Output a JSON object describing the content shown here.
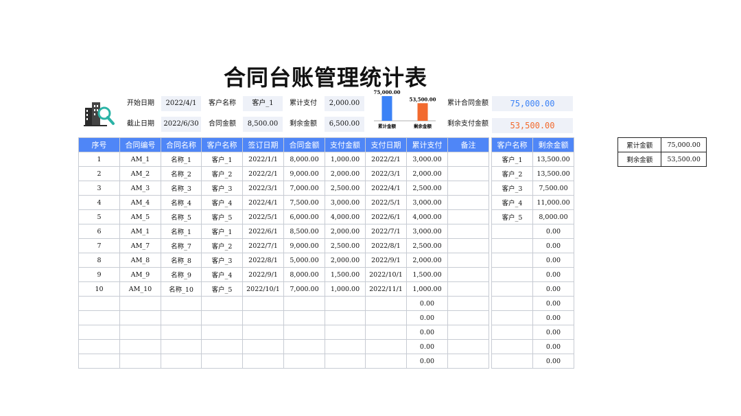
{
  "title": "合同台账管理统计表",
  "colors": {
    "header_bg": "#4f86f7",
    "accent_blue": "#3b82f6",
    "accent_orange": "#f26a2e",
    "field_bg": "#eef1f8"
  },
  "icons": {
    "logo": "building-magnifier-icon"
  },
  "info": {
    "start_date_label": "开始日期",
    "start_date": "2022/4/1",
    "end_date_label": "截止日期",
    "end_date": "2022/6/30",
    "customer_label": "客户名称",
    "customer": "客户_1",
    "contract_amount_label": "合同金额",
    "contract_amount": "8,500.00",
    "cum_pay_label": "累计支付",
    "cum_pay": "2,000.00",
    "remaining_label": "剩余金额",
    "remaining": "6,500.00",
    "cum_contract_total_label": "累计合同金额",
    "cum_contract_total": "75,000.00",
    "remaining_pay_total_label": "剩余支付金额",
    "remaining_pay_total": "53,500.00"
  },
  "chart_data": {
    "type": "bar",
    "categories": [
      "累计金额",
      "剩余金额"
    ],
    "values": [
      75000,
      53500
    ],
    "data_labels": [
      "75,000.00",
      "53,500.00"
    ],
    "colors": [
      "#3b82f6",
      "#f26a2e"
    ]
  },
  "main_table": {
    "headers": [
      "序号",
      "合同编号",
      "合同名称",
      "客户名称",
      "签订日期",
      "合同金额",
      "支付金额",
      "支付日期",
      "累计支付",
      "备注"
    ],
    "rows": [
      [
        "1",
        "AM_1",
        "名称_1",
        "客户_1",
        "2022/1/1",
        "8,000.00",
        "1,000.00",
        "2022/2/1",
        "3,000.00",
        ""
      ],
      [
        "2",
        "AM_2",
        "名称_2",
        "客户_2",
        "2022/2/1",
        "9,000.00",
        "2,000.00",
        "2022/3/1",
        "2,000.00",
        ""
      ],
      [
        "3",
        "AM_3",
        "名称_3",
        "客户_3",
        "2022/3/1",
        "7,000.00",
        "2,500.00",
        "2022/4/1",
        "2,500.00",
        ""
      ],
      [
        "4",
        "AM_4",
        "名称_4",
        "客户_4",
        "2022/4/1",
        "7,500.00",
        "3,000.00",
        "2022/5/1",
        "3,000.00",
        ""
      ],
      [
        "5",
        "AM_5",
        "名称_5",
        "客户_5",
        "2022/5/1",
        "6,000.00",
        "4,000.00",
        "2022/6/1",
        "4,000.00",
        ""
      ],
      [
        "6",
        "AM_1",
        "名称_1",
        "客户_1",
        "2022/6/1",
        "8,500.00",
        "2,000.00",
        "2022/7/1",
        "3,000.00",
        ""
      ],
      [
        "7",
        "AM_7",
        "名称_7",
        "客户_2",
        "2022/7/1",
        "9,000.00",
        "2,500.00",
        "2022/8/1",
        "2,500.00",
        ""
      ],
      [
        "8",
        "AM_8",
        "名称_8",
        "客户_3",
        "2022/8/1",
        "5,000.00",
        "2,000.00",
        "2022/9/1",
        "2,000.00",
        ""
      ],
      [
        "9",
        "AM_9",
        "名称_9",
        "客户_4",
        "2022/9/1",
        "8,000.00",
        "1,500.00",
        "2022/10/1",
        "1,500.00",
        ""
      ],
      [
        "10",
        "AM_10",
        "名称_10",
        "客户_5",
        "2022/10/1",
        "7,000.00",
        "1,000.00",
        "2022/11/1",
        "1,000.00",
        ""
      ],
      [
        "",
        "",
        "",
        "",
        "",
        "",
        "",
        "",
        "0.00",
        ""
      ],
      [
        "",
        "",
        "",
        "",
        "",
        "",
        "",
        "",
        "0.00",
        ""
      ],
      [
        "",
        "",
        "",
        "",
        "",
        "",
        "",
        "",
        "0.00",
        ""
      ],
      [
        "",
        "",
        "",
        "",
        "",
        "",
        "",
        "",
        "0.00",
        ""
      ],
      [
        "",
        "",
        "",
        "",
        "",
        "",
        "",
        "",
        "0.00",
        ""
      ]
    ]
  },
  "customer_table": {
    "headers": [
      "客户名称",
      "剩余金额"
    ],
    "rows": [
      [
        "客户_1",
        "13,500.00"
      ],
      [
        "客户_2",
        "13,500.00"
      ],
      [
        "客户_3",
        "7,500.00"
      ],
      [
        "客户_4",
        "11,000.00"
      ],
      [
        "客户_5",
        "8,000.00"
      ],
      [
        "",
        "0.00"
      ],
      [
        "",
        "0.00"
      ],
      [
        "",
        "0.00"
      ],
      [
        "",
        "0.00"
      ],
      [
        "",
        "0.00"
      ],
      [
        "",
        "0.00"
      ],
      [
        "",
        "0.00"
      ],
      [
        "",
        "0.00"
      ],
      [
        "",
        "0.00"
      ],
      [
        "",
        "0.00"
      ]
    ]
  },
  "summary": [
    {
      "label": "累计金额",
      "value": "75,000.00"
    },
    {
      "label": "剩余金额",
      "value": "53,500.00"
    }
  ]
}
